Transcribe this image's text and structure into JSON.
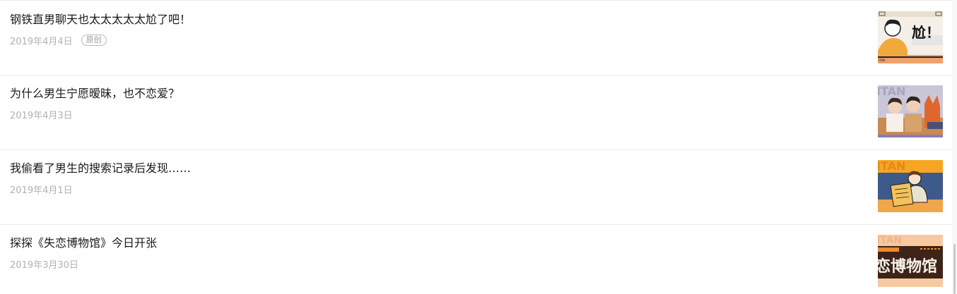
{
  "articles": [
    {
      "title": "钢铁直男聊天也太太太太太尬了吧！",
      "date": "2019年4月4日",
      "badge": "原创",
      "thumb_text": "尬！",
      "thumb_caption": "ITAN"
    },
    {
      "title": "为什么男生宁愿暧昧，也不恋爱？",
      "date": "2019年4月3日",
      "thumb_text": "ITAN"
    },
    {
      "title": "我偷看了男生的搜索记录后发现……",
      "date": "2019年4月1日",
      "thumb_text": "ITAN"
    },
    {
      "title": "探探《失恋博物馆》今日开张",
      "date": "2019年3月30日",
      "thumb_text": "恋博物馆",
      "thumb_caption": "ITAN"
    }
  ],
  "colors": {
    "title": "#1a1a1a",
    "meta": "#b2b2b2",
    "divider": "#ececec"
  }
}
